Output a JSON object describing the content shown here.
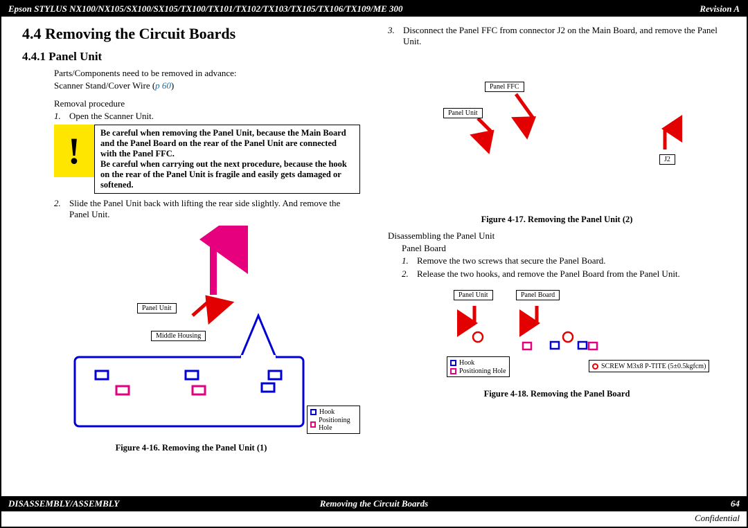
{
  "header": {
    "left": "Epson STYLUS NX100/NX105/SX100/SX105/TX100/TX101/TX102/TX103/TX105/TX106/TX109/ME 300",
    "right": "Revision A"
  },
  "footer": {
    "left": "DISASSEMBLY/ASSEMBLY",
    "center": "Removing the Circuit Boards",
    "right": "64",
    "confidential": "Confidential"
  },
  "left": {
    "h1": "4.4  Removing the Circuit Boards",
    "h2": "4.4.1  Panel Unit",
    "intro1": "Parts/Components need to be removed in advance:",
    "intro2a": "Scanner Stand/Cover Wire (",
    "intro2b": "p 60",
    "intro2c": ")",
    "procedure_label": "Removal procedure",
    "step1": "Open the Scanner Unit.",
    "warn_p1": "Be careful when removing the Panel Unit, because the Main Board and the Panel Board on the rear of the Panel Unit are connected with the Panel FFC.",
    "warn_p2": "Be careful when carrying out the next procedure, because the hook on the rear of the Panel Unit is fragile and easily gets damaged or softened.",
    "step2": "Slide the Panel Unit back with lifting the rear side slightly. And remove the Panel Unit.",
    "label_panel_unit": "Panel Unit",
    "label_middle_housing": "Middle Housing",
    "legend_hook": "Hook",
    "legend_pos": "Positioning Hole",
    "figcap": "Figure 4-16.  Removing the Panel Unit (1)"
  },
  "right": {
    "step3": "Disconnect the Panel FFC from connector J2 on the Main Board, and remove the Panel Unit.",
    "label_panel_ffc": "Panel FFC",
    "label_panel_unit": "Panel Unit",
    "label_j2": "J2",
    "figcap1": "Figure 4-17.  Removing the Panel Unit (2)",
    "disassembling": "Disassembling the Panel Unit",
    "panel_board": "Panel Board",
    "pb_step1": "Remove the two screws that secure the Panel Board.",
    "pb_step2": "Release the two hooks, and remove the Panel Board from the Panel Unit.",
    "label_panel_unit2": "Panel Unit",
    "label_panel_board": "Panel Board",
    "legend_hook": "Hook",
    "legend_pos": "Positioning Hole",
    "legend_screw": "SCREW M3x8 P-TITE (5±0.5kgfcm)",
    "figcap2": "Figure 4-18.  Removing the Panel Board"
  }
}
